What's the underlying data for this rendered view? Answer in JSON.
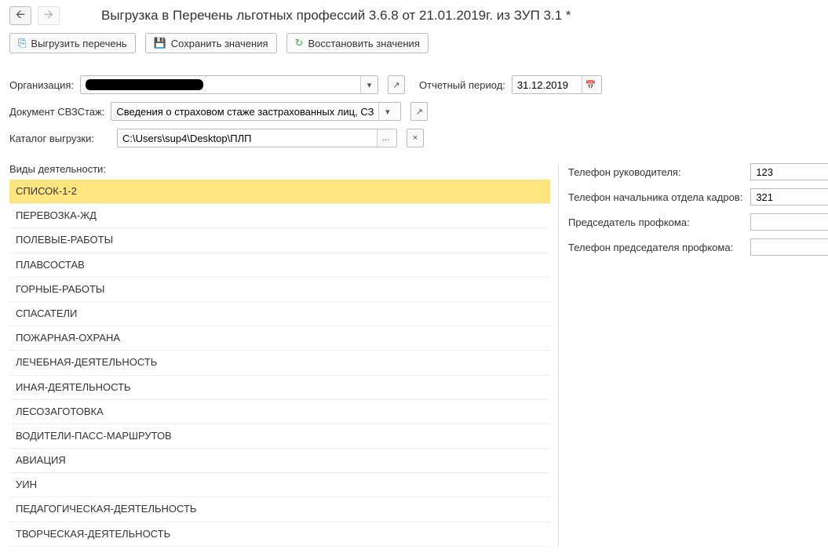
{
  "title": "Выгрузка в Перечень льготных профессий 3.6.8 от 21.01.2019г. из ЗУП 3.1 *",
  "toolbar": {
    "export_label": "Выгрузить перечень",
    "save_label": "Сохранить значения",
    "restore_label": "Восстановить значения"
  },
  "form": {
    "organization_label": "Организация:",
    "organization_value": "",
    "period_label": "Отчетный период:",
    "period_value": "31.12.2019",
    "doc_label": "Документ СВЗСтаж:",
    "doc_value": "Сведения о страховом стаже застрахованных лиц, СЗВ-СТА",
    "catalog_label": "Каталог выгрузки:",
    "catalog_value": "C:\\Users\\sup4\\Desktop\\ПЛП"
  },
  "activities": {
    "label": "Виды деятельности:",
    "items": [
      "СПИСОК-1-2",
      "ПЕРЕВОЗКА-ЖД",
      "ПОЛЕВЫЕ-РАБОТЫ",
      "ПЛАВСОСТАВ",
      "ГОРНЫЕ-РАБОТЫ",
      "СПАСАТЕЛИ",
      "ПОЖАРНАЯ-ОХРАНА",
      "ЛЕЧЕБНАЯ-ДЕЯТЕЛЬНОСТЬ",
      "ИНАЯ-ДЕЯТЕЛЬНОСТЬ",
      "ЛЕСОЗАГОТОВКА",
      "ВОДИТЕЛИ-ПАСС-МАРШРУТОВ",
      "АВИАЦИЯ",
      "УИН",
      "ПЕДАГОГИЧЕСКАЯ-ДЕЯТЕЛЬНОСТЬ",
      "ТВОРЧЕСКАЯ-ДЕЯТЕЛЬНОСТЬ"
    ],
    "selected_index": 0
  },
  "right": {
    "phone_head_label": "Телефон руководителя:",
    "phone_head_value": "123",
    "phone_hr_label": "Телефон начальника отдела кадров:",
    "phone_hr_value": "321",
    "chair_label": "Председатель профкома:",
    "chair_value": "",
    "phone_chair_label": "Телефон председателя профкома:",
    "phone_chair_value": ""
  }
}
